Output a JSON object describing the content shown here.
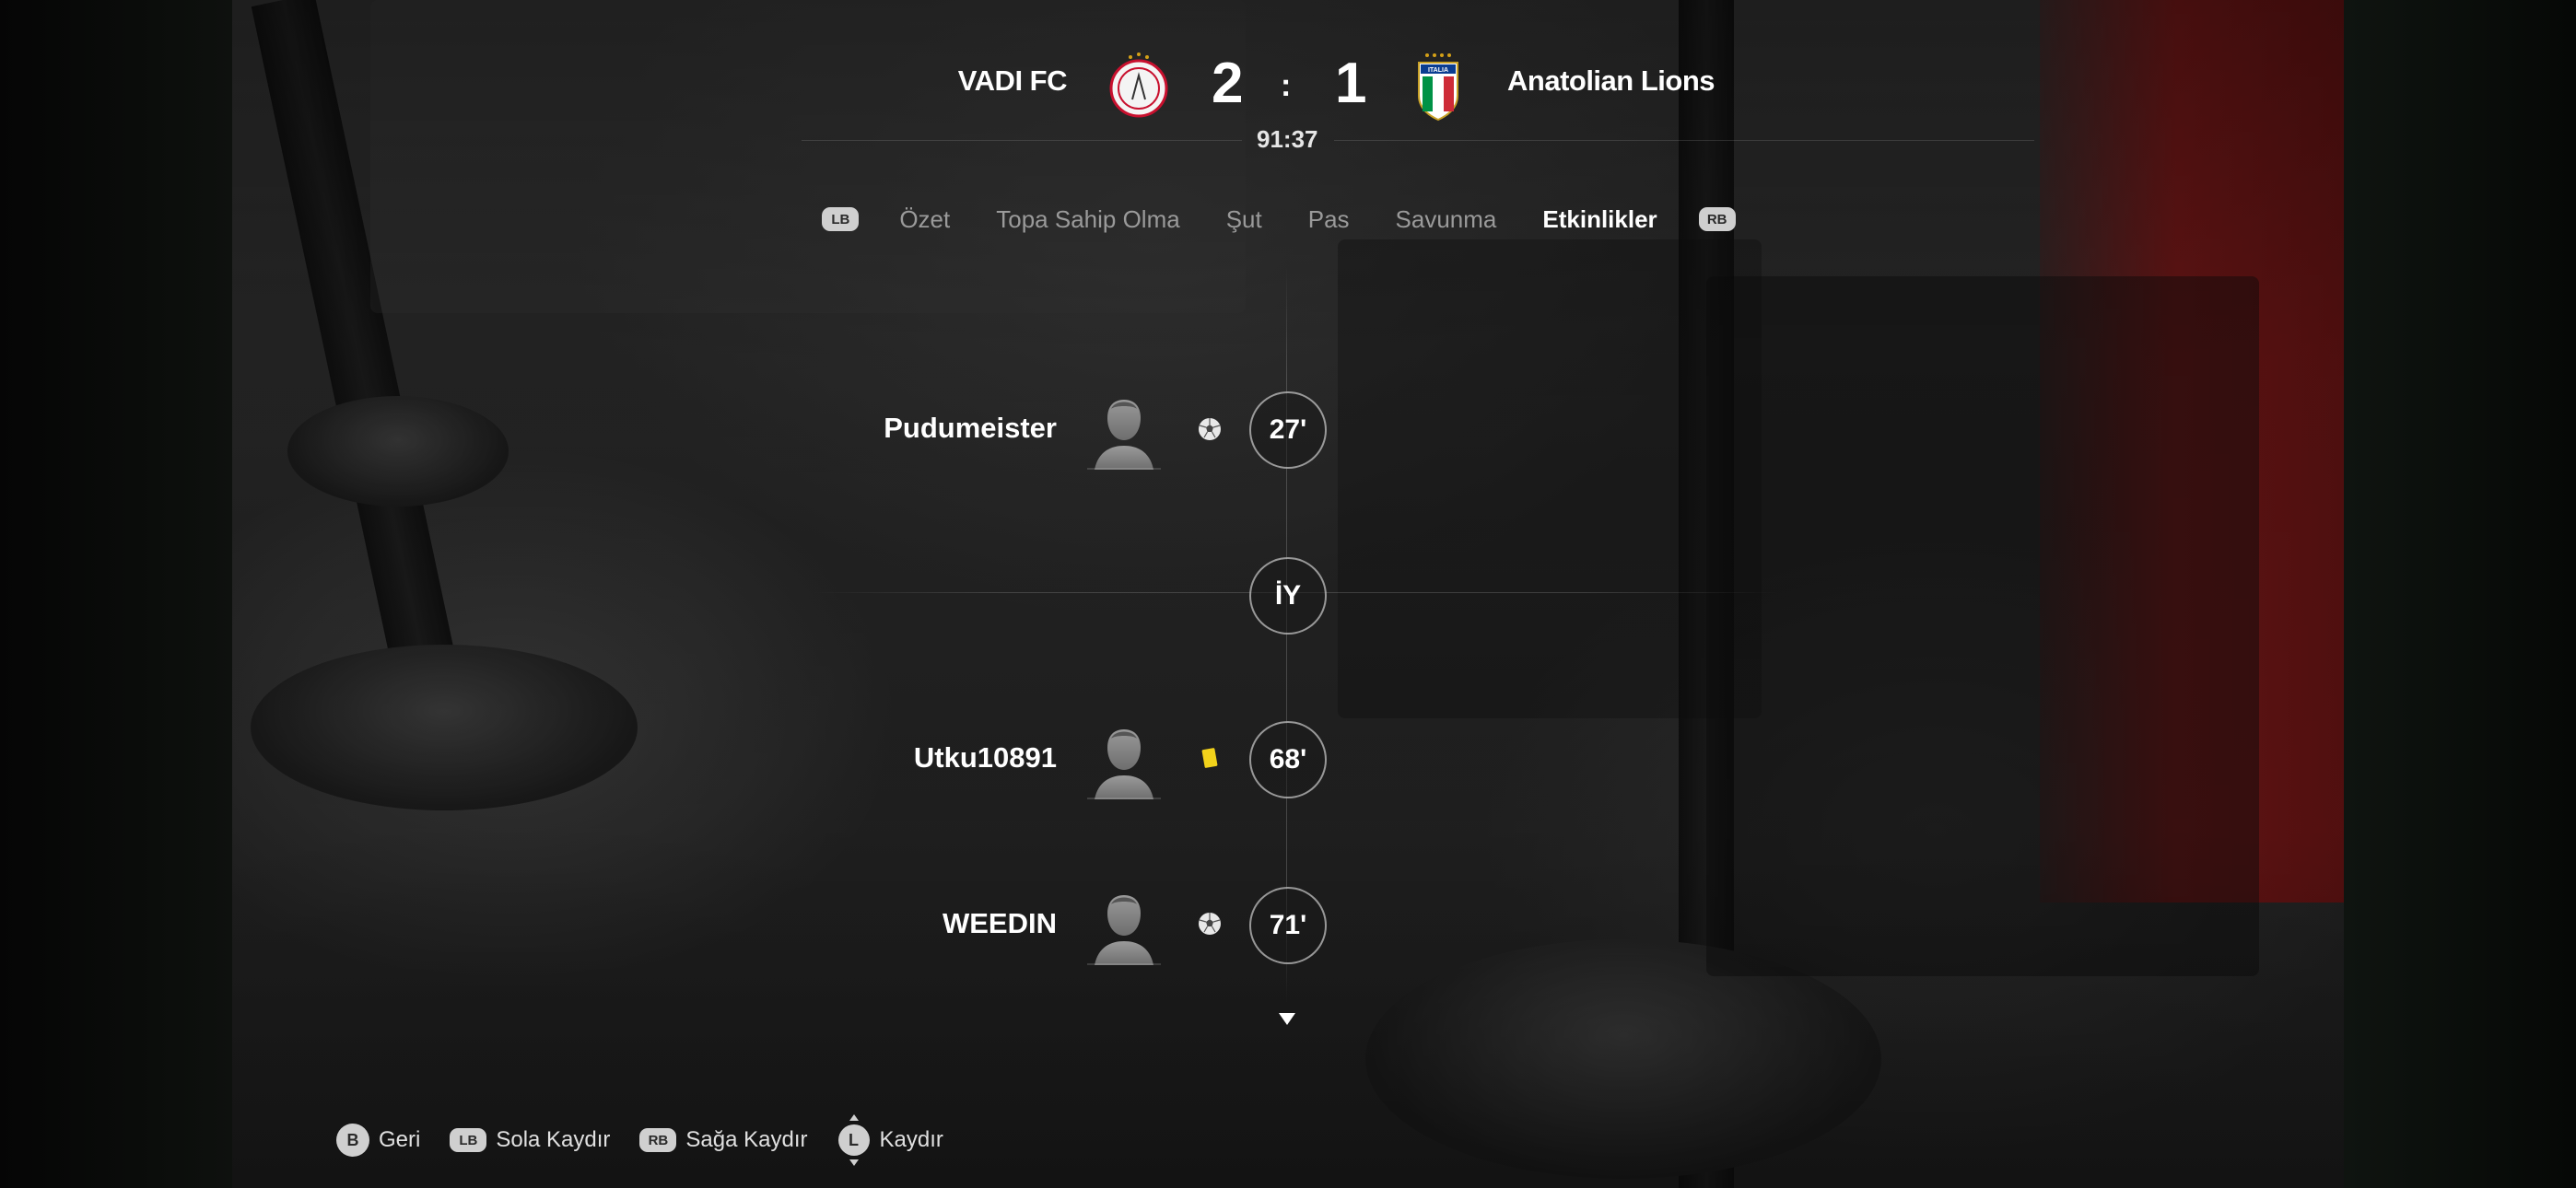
{
  "match": {
    "home_team": "VADI FC",
    "away_team": "Anatolian Lions",
    "home_score": "2",
    "score_separator": ":",
    "away_score": "1",
    "clock": "91:37",
    "away_crest_text": "ITALIA"
  },
  "tabs": {
    "left_button": "LB",
    "right_button": "RB",
    "items": [
      {
        "label": "Özet",
        "active": false
      },
      {
        "label": "Topa Sahip Olma",
        "active": false
      },
      {
        "label": "Şut",
        "active": false
      },
      {
        "label": "Pas",
        "active": false
      },
      {
        "label": "Savunma",
        "active": false
      },
      {
        "label": "Etkinlikler",
        "active": true
      }
    ]
  },
  "events": [
    {
      "player": "Pudumeister",
      "type": "goal",
      "icon": "ball-icon",
      "minute": "27'"
    },
    {
      "marker": "İY"
    },
    {
      "player": "Utku10891",
      "type": "yellow-card",
      "icon": "yellow-card-icon",
      "minute": "68'"
    },
    {
      "player": "WEEDIN",
      "type": "goal",
      "icon": "ball-icon",
      "minute": "71'"
    }
  ],
  "footer": {
    "back_button": "B",
    "back_label": "Geri",
    "scroll_left_button": "LB",
    "scroll_left_label": "Sola Kaydır",
    "scroll_right_button": "RB",
    "scroll_right_label": "Sağa Kaydır",
    "scroll_button": "L",
    "scroll_label": "Kaydır"
  },
  "colors": {
    "active_tab": "#ffffff",
    "inactive_tab": "#9a9a9a",
    "yellow_card": "#f2d21b"
  }
}
